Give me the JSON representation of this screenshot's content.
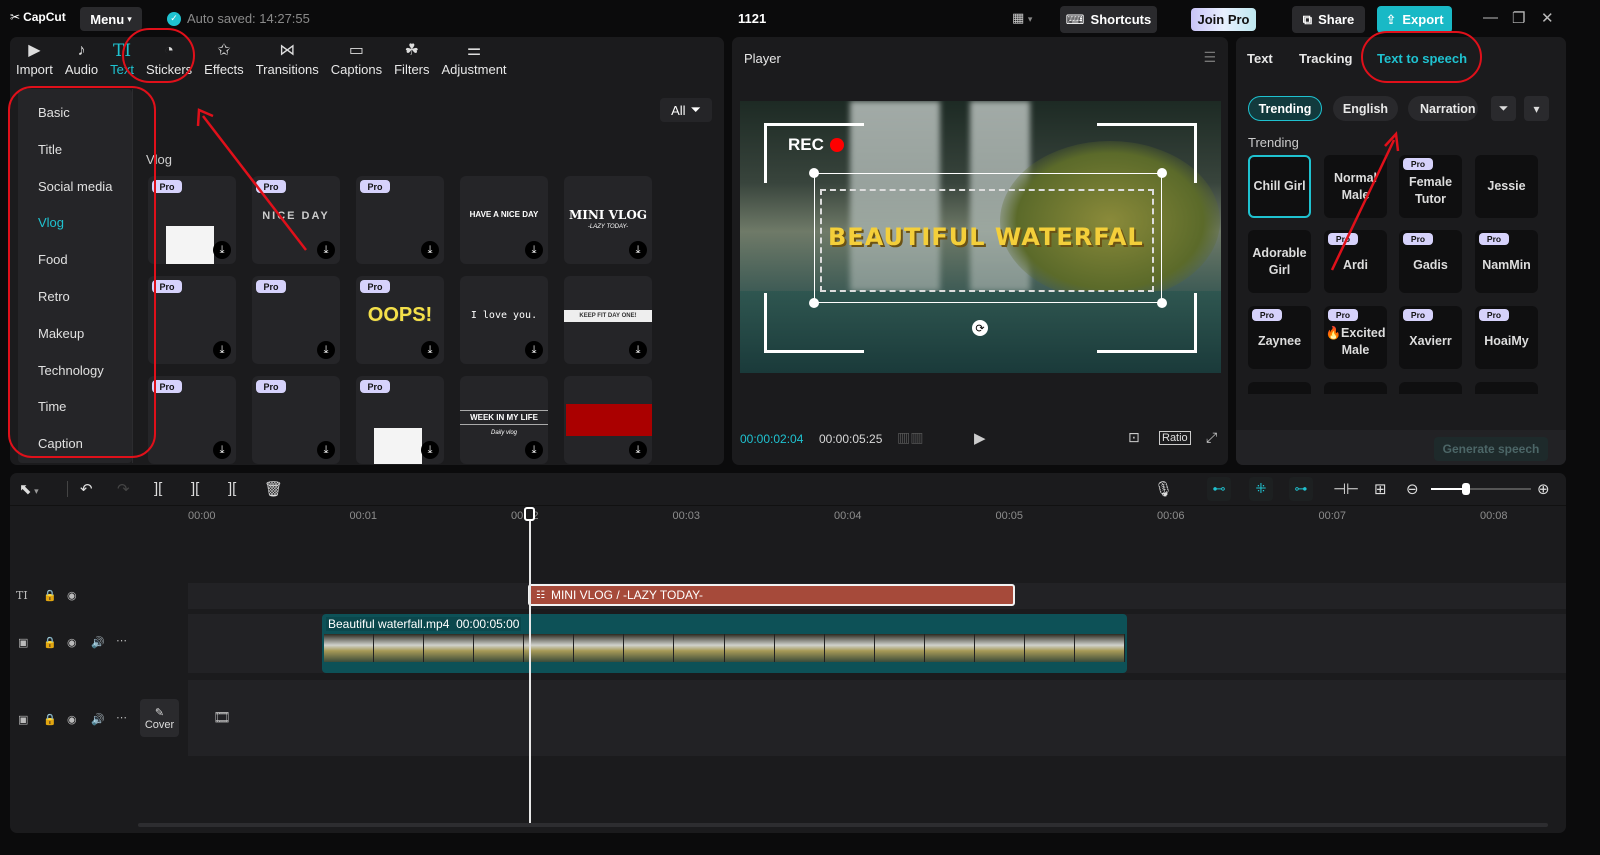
{
  "app": {
    "logo": "CapCut",
    "menu_label": "Menu",
    "autosave": "Auto saved: 14:27:55",
    "project_title": "1121",
    "shortcuts_label": "Shortcuts",
    "join_pro_label": "Join Pro",
    "share_label": "Share",
    "export_label": "Export"
  },
  "media_toolbar": [
    {
      "label": "Import",
      "icon": "import-icon",
      "glyph": "▶"
    },
    {
      "label": "Audio",
      "icon": "audio-icon",
      "glyph": "♪"
    },
    {
      "label": "Text",
      "icon": "text-icon",
      "glyph": "TI",
      "active": true
    },
    {
      "label": "Stickers",
      "icon": "stickers-icon",
      "glyph": "◔"
    },
    {
      "label": "Effects",
      "icon": "effects-icon",
      "glyph": "✩"
    },
    {
      "label": "Transitions",
      "icon": "transitions-icon",
      "glyph": "⋈"
    },
    {
      "label": "Captions",
      "icon": "captions-icon",
      "glyph": "▭"
    },
    {
      "label": "Filters",
      "icon": "filters-icon",
      "glyph": "☘"
    },
    {
      "label": "Adjustment",
      "icon": "adjustment-icon",
      "glyph": "⚌"
    }
  ],
  "categories": [
    "Basic",
    "Title",
    "Social media",
    "Vlog",
    "Food",
    "Retro",
    "Makeup",
    "Technology",
    "Time",
    "Caption"
  ],
  "active_category": "Vlog",
  "filter_label": "All",
  "section_title": "Vlog",
  "templates": [
    {
      "pro": true,
      "text": ""
    },
    {
      "pro": true,
      "text": "NICE DAY"
    },
    {
      "pro": true,
      "text": ""
    },
    {
      "pro": false,
      "text": "HAVE A NICE DAY"
    },
    {
      "pro": false,
      "text": "MINI VLOG",
      "sub": "-LAZY TODAY-"
    },
    {
      "pro": true,
      "text": ""
    },
    {
      "pro": true,
      "text": ""
    },
    {
      "pro": true,
      "text": "OOPS!"
    },
    {
      "pro": false,
      "text": "I love you."
    },
    {
      "pro": false,
      "text": "KEEP FIT DAY ONE!"
    },
    {
      "pro": true,
      "text": ""
    },
    {
      "pro": true,
      "text": ""
    },
    {
      "pro": true,
      "text": ""
    },
    {
      "pro": false,
      "text": "WEEK IN MY LIFE",
      "sub": "Daily vlog"
    },
    {
      "pro": false,
      "text": ""
    }
  ],
  "pro_badge": "Pro",
  "player": {
    "title": "Player",
    "rec_label": "REC",
    "overlay_text": "BEAUTIFUL WATERFAL",
    "current_time": "00:00:02:04",
    "total_time": "00:00:05:25",
    "ratio_label": "Ratio"
  },
  "props": {
    "tabs": [
      "Text",
      "Tracking",
      "Text to speech"
    ],
    "active_tab": "Text to speech",
    "filters": [
      "Trending",
      "English",
      "Narration"
    ],
    "active_filter": "Trending",
    "section_label": "Trending",
    "voices": [
      {
        "name": "Chill Girl",
        "pro": false,
        "active": true
      },
      {
        "name": "Normal Male",
        "pro": false
      },
      {
        "name": "Female Tutor",
        "pro": true
      },
      {
        "name": "Jessie",
        "pro": false
      },
      {
        "name": "Adorable Girl",
        "pro": false
      },
      {
        "name": "Ardi",
        "pro": true
      },
      {
        "name": "Gadis",
        "pro": true
      },
      {
        "name": "NamMin",
        "pro": true
      },
      {
        "name": "Zaynee",
        "pro": true
      },
      {
        "name": "🔥Excited Male",
        "pro": true
      },
      {
        "name": "Xavierr",
        "pro": true
      },
      {
        "name": "HoaiMy",
        "pro": true
      }
    ],
    "generate_label": "Generate speech"
  },
  "timeline": {
    "ruler": [
      "00:00",
      "00:01",
      "00:02",
      "00:03",
      "00:04",
      "00:05",
      "00:06",
      "00:07",
      "00:08"
    ],
    "text_clip": "MINI VLOG / -LAZY TODAY-",
    "video_clip_name": "Beautiful waterfall.mp4",
    "video_clip_duration": "00:00:05:00",
    "cover_label": "Cover",
    "zoom_level": 0.35
  },
  "annotation_color": "#e0101a"
}
